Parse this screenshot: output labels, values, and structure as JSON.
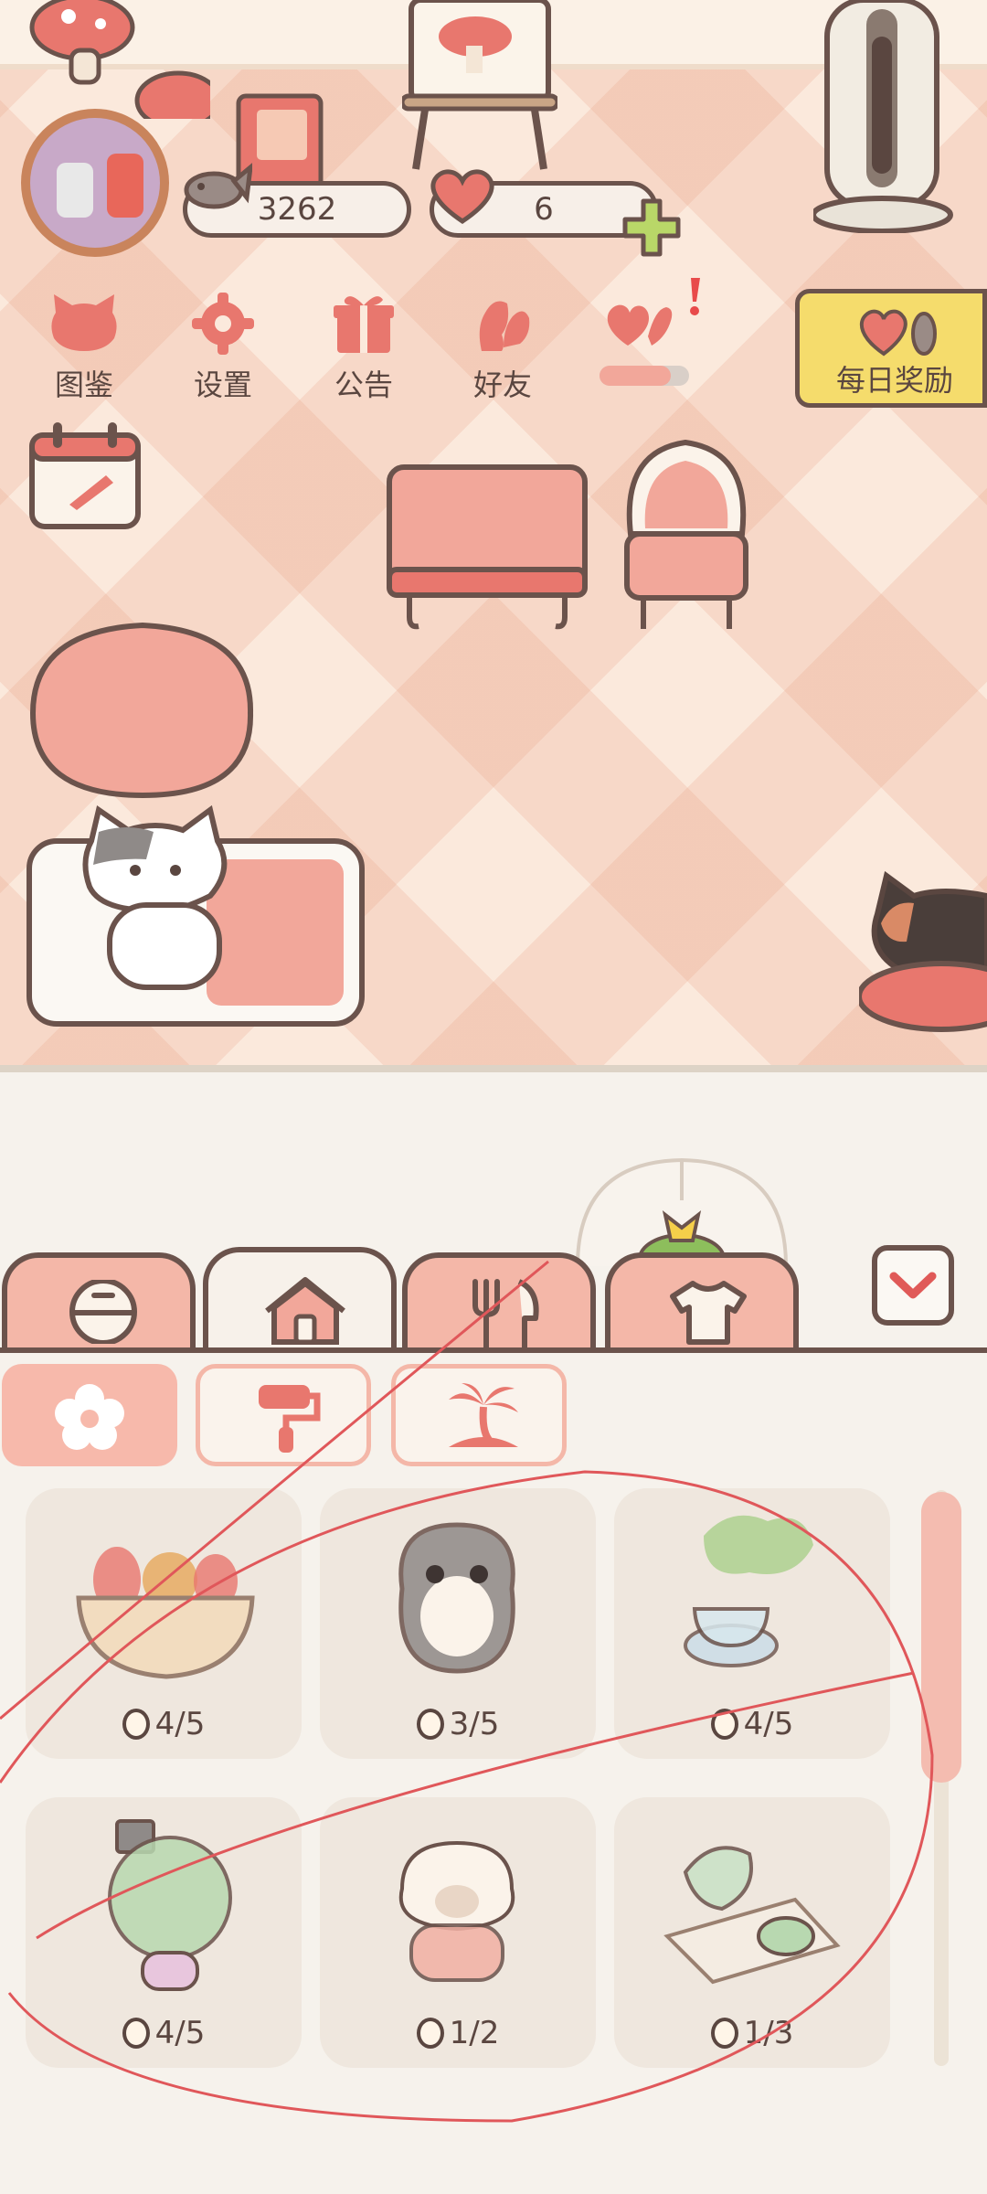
{
  "currency": {
    "fish_count": "3262",
    "heart_count": "6"
  },
  "menu": {
    "items": [
      {
        "label": "图鉴",
        "icon": "cat-face-icon"
      },
      {
        "label": "设置",
        "icon": "gear-icon"
      },
      {
        "label": "公告",
        "icon": "gift-icon"
      },
      {
        "label": "好友",
        "icon": "friends-icon"
      },
      {
        "label": "",
        "icon": "heart-hand-icon"
      }
    ],
    "daily_reward_label": "每日奖励"
  },
  "tabs": [
    {
      "name": "tab-food-bowl",
      "icon": "bowl-icon"
    },
    {
      "name": "tab-furniture",
      "icon": "house-icon"
    },
    {
      "name": "tab-dining",
      "icon": "fork-knife-icon"
    },
    {
      "name": "tab-clothing",
      "icon": "shirt-icon"
    }
  ],
  "subtabs": [
    {
      "icon": "flower-icon",
      "active": true
    },
    {
      "icon": "paint-roller-icon",
      "active": false
    },
    {
      "icon": "palm-island-icon",
      "active": false
    }
  ],
  "collection": [
    {
      "item": "vegetable-basket",
      "count": "4/5"
    },
    {
      "item": "owl-plush",
      "count": "3/5"
    },
    {
      "item": "tea-set",
      "count": "4/5"
    },
    {
      "item": "topiary-tree",
      "count": "4/5"
    },
    {
      "item": "puppy-cushion",
      "count": "1/2"
    },
    {
      "item": "ice-cream-tray",
      "count": "1/3"
    }
  ],
  "colors": {
    "accent_pink": "#f4b7a8",
    "outline_brown": "#6b534c",
    "reward_yellow": "#f5dc6c",
    "annotation_red": "#e0575a"
  }
}
